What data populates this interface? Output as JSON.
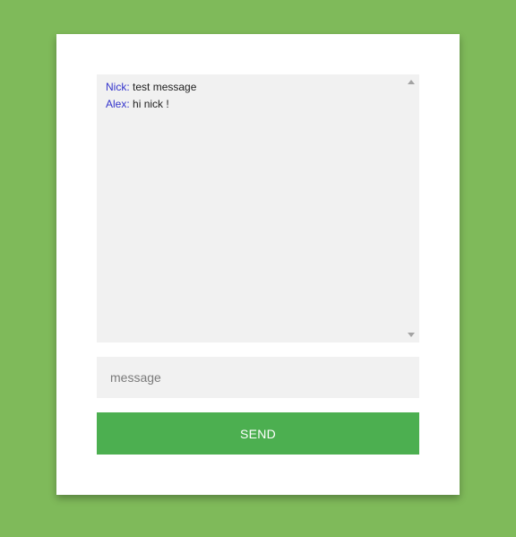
{
  "chat": {
    "messages": [
      {
        "author": "Nick:",
        "text": "test message"
      },
      {
        "author": "Alex:",
        "text": "hi nick !"
      }
    ]
  },
  "input": {
    "placeholder": "message",
    "value": ""
  },
  "send_button": {
    "label": "SEND"
  },
  "colors": {
    "background": "#7fba5a",
    "card": "#ffffff",
    "field": "#f1f1f1",
    "author": "#3333cc",
    "button": "#4caf50"
  },
  "icons": {
    "scroll_up": "scroll-up-arrow-icon",
    "scroll_down": "scroll-down-arrow-icon"
  }
}
